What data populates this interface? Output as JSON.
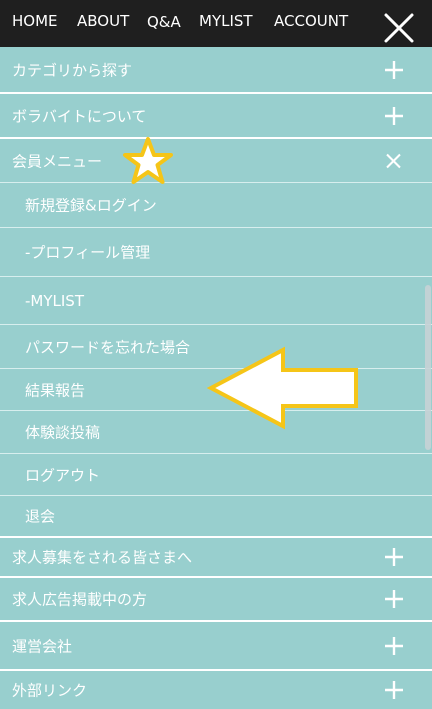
{
  "topnav": {
    "home": "HOME",
    "about": "ABOUT",
    "qa": "Q&A",
    "mylist": "MYLIST",
    "account": "ACCOUNT"
  },
  "menu": {
    "category": "カテゴリから探す",
    "about_borabaito": "ボラバイトについて",
    "member_menu": "会員メニュー",
    "member_items": [
      "新規登録&ログイン",
      "-プロフィール管理",
      "-MYLIST",
      "パスワードを忘れた場合",
      "結果報告",
      "体験談投稿",
      "ログアウト",
      "退会"
    ],
    "recruiters": "求人募集をされる皆さまへ",
    "advertisers": "求人広告掲載中の方",
    "company": "運営会社",
    "external_links": "外部リンク"
  },
  "colors": {
    "topbar": "#1f1f1f",
    "menu_bg": "#98cfce",
    "text": "#ffffff",
    "highlight": "#f5c518"
  },
  "icons": {
    "close": "close-icon",
    "expand": "plus-icon",
    "collapse": "x-icon",
    "annotation_star": "star-icon",
    "annotation_arrow": "arrow-left-icon"
  }
}
